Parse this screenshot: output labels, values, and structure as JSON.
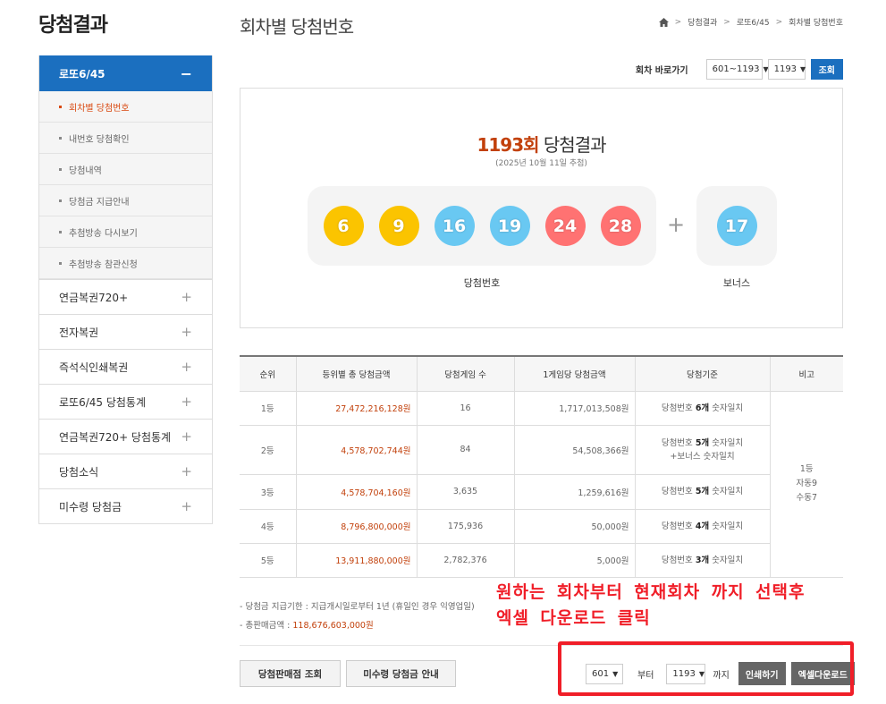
{
  "page_title": "당첨결과",
  "lnb": {
    "active_head": {
      "label": "로또6/45",
      "toggle": "−"
    },
    "sub_items": [
      {
        "label": "회차별 당첨번호",
        "active": true
      },
      {
        "label": "내번호 당첨확인"
      },
      {
        "label": "당첨내역"
      },
      {
        "label": "당첨금 지급안내"
      },
      {
        "label": "추첨방송 다시보기"
      },
      {
        "label": "추첨방송 참관신청"
      }
    ],
    "items": [
      {
        "label": "연금복권720+",
        "toggle": "+"
      },
      {
        "label": "전자복권",
        "toggle": "+"
      },
      {
        "label": "즉석식인쇄복권",
        "toggle": "+"
      },
      {
        "label": "로또6/45 당첨통계",
        "toggle": "+"
      },
      {
        "label": "연금복권720+ 당첨통계",
        "toggle": "+"
      },
      {
        "label": "당첨소식",
        "toggle": "+"
      },
      {
        "label": "미수령 당첨금",
        "toggle": "+"
      }
    ]
  },
  "header": {
    "sub_title": "회차별 당첨번호",
    "breadcrumb": [
      "당첨결과",
      "로또6/45",
      "회차별 당첨번호"
    ],
    "breadcrumb_sep": ">"
  },
  "goto": {
    "label": "회차 바로가기",
    "range_select": "601~1193",
    "round_select": "1193",
    "button": "조회"
  },
  "result": {
    "round_num": "1193회",
    "title_suffix": " 당첨결과",
    "date": "(2025년 10월 11일 추첨)",
    "plus": "+",
    "win_caption": "당첨번호",
    "bonus_caption": "보너스",
    "balls": [
      {
        "value": "6",
        "color": "#fbc400"
      },
      {
        "value": "9",
        "color": "#fbc400"
      },
      {
        "value": "16",
        "color": "#69c8f2"
      },
      {
        "value": "19",
        "color": "#69c8f2"
      },
      {
        "value": "24",
        "color": "#ff7272"
      },
      {
        "value": "28",
        "color": "#ff7272"
      }
    ],
    "bonus_ball": {
      "value": "17",
      "color": "#69c8f2"
    }
  },
  "table": {
    "headers": [
      "순위",
      "등위별 총 당첨금액",
      "당첨게임 수",
      "1게임당 당첨금액",
      "당첨기준",
      "비고"
    ],
    "rows": [
      {
        "rank": "1등",
        "total": "27,472,216,128원",
        "games": "16",
        "per_game": "1,717,013,508원",
        "crit_a": "당첨번호 ",
        "crit_b": "6개",
        "crit_c": " 숫자일치",
        "crit2": ""
      },
      {
        "rank": "2등",
        "total": "4,578,702,744원",
        "games": "84",
        "per_game": "54,508,366원",
        "crit_a": "당첨번호 ",
        "crit_b": "5개",
        "crit_c": " 숫자일치",
        "crit2": "+보너스 숫자일치"
      },
      {
        "rank": "3등",
        "total": "4,578,704,160원",
        "games": "3,635",
        "per_game": "1,259,616원",
        "crit_a": "당첨번호 ",
        "crit_b": "5개",
        "crit_c": " 숫자일치",
        "crit2": ""
      },
      {
        "rank": "4등",
        "total": "8,796,800,000원",
        "games": "175,936",
        "per_game": "50,000원",
        "crit_a": "당첨번호 ",
        "crit_b": "4개",
        "crit_c": " 숫자일치",
        "crit2": ""
      },
      {
        "rank": "5등",
        "total": "13,911,880,000원",
        "games": "2,782,376",
        "per_game": "5,000원",
        "crit_a": "당첨번호 ",
        "crit_b": "3개",
        "crit_c": " 숫자일치",
        "crit2": ""
      }
    ],
    "note": {
      "line1": "1등",
      "line2": "자동9",
      "line3": "수동7"
    }
  },
  "notes": {
    "line1": "-  당첨금 지급기한 : 지급개시일로부터 1년 (휴일인 경우 익영업일)",
    "line2_label": "-  총판매금액 : ",
    "line2_amount": "118,676,603,000원"
  },
  "buttons": {
    "store_search": "당첨판매점 조회",
    "unclaimed": "미수령 당첨금 안내"
  },
  "download": {
    "from": "601",
    "from_label": "부터",
    "to": "1193",
    "to_label": "까지",
    "print": "인쇄하기",
    "excel": "엑셀다운로드"
  },
  "annotation": {
    "line1": "원하는 회차부터 현재회차 까지 선택후",
    "line2": "엑셀 다운로드 클릭"
  },
  "colors": {
    "brand_blue": "#1b6fbf",
    "accent_orange": "#c2410c",
    "annotation_red": "#f01e28"
  }
}
